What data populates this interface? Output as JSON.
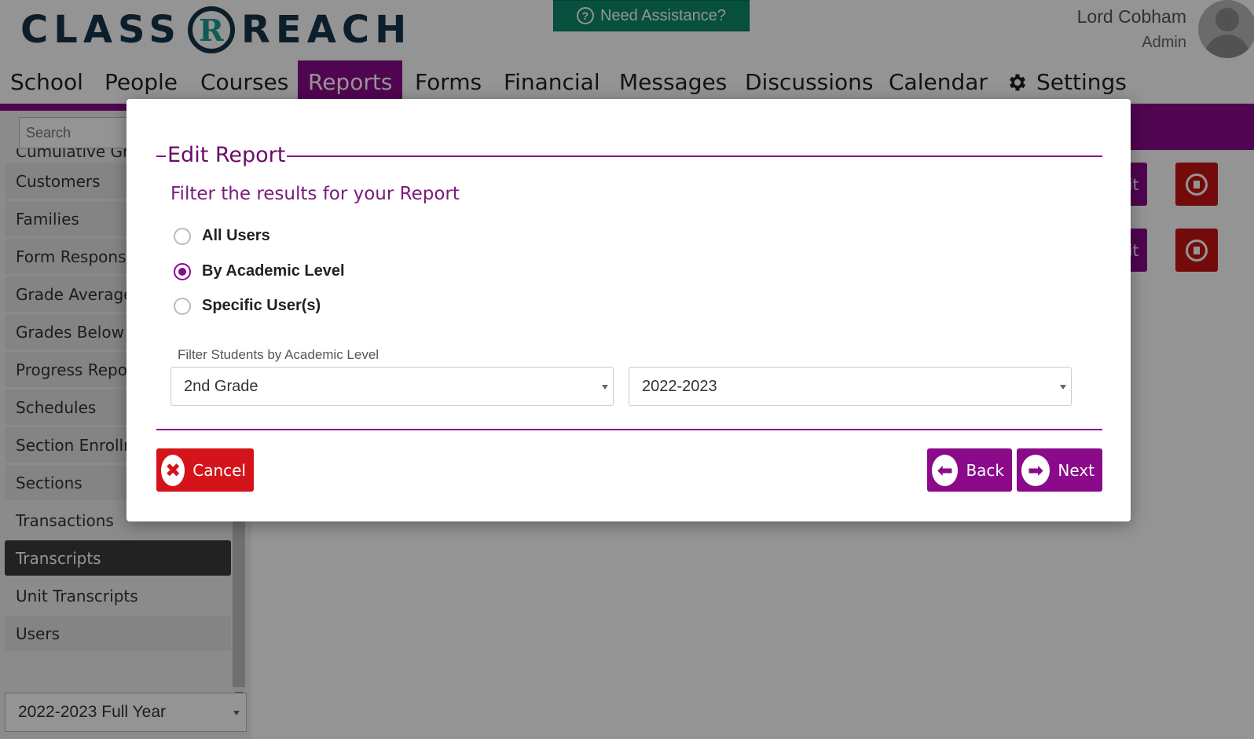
{
  "header": {
    "logo_left": "CLASS",
    "logo_mark": "R",
    "logo_right": "REACH",
    "assist_label": "Need Assistance?",
    "user_name": "Lord Cobham",
    "user_role": "Admin"
  },
  "nav": {
    "items": [
      {
        "label": "School"
      },
      {
        "label": "People"
      },
      {
        "label": "Courses"
      },
      {
        "label": "Reports",
        "active": true
      },
      {
        "label": "Forms"
      },
      {
        "label": "Financial"
      },
      {
        "label": "Messages"
      },
      {
        "label": "Discussions"
      },
      {
        "label": "Calendar"
      },
      {
        "label": "Settings",
        "icon": "gear-icon"
      }
    ]
  },
  "sidebar": {
    "search_placeholder": "Search",
    "items": [
      {
        "label": "Cumulative Gra"
      },
      {
        "label": "Customers"
      },
      {
        "label": "Families"
      },
      {
        "label": "Form Responses"
      },
      {
        "label": "Grade Averages"
      },
      {
        "label": "Grades Below (("
      },
      {
        "label": "Progress Report"
      },
      {
        "label": "Schedules"
      },
      {
        "label": "Section Enrollm"
      },
      {
        "label": "Sections"
      },
      {
        "label": "Transactions"
      },
      {
        "label": "Transcripts",
        "active": true
      },
      {
        "label": "Unit Transcripts"
      },
      {
        "label": "Users"
      }
    ],
    "term_select": "2022-2023 Full Year"
  },
  "rows": {
    "edit_label": "Edit"
  },
  "modal": {
    "legend": "Edit Report",
    "subtitle": "Filter the results for your Report",
    "options": [
      {
        "label": "All Users",
        "checked": false
      },
      {
        "label": "By Academic Level",
        "checked": true
      },
      {
        "label": "Specific User(s)",
        "checked": false
      }
    ],
    "filter_label": "Filter Students by Academic Level",
    "level_select": "2nd Grade",
    "year_select": "2022-2023",
    "cancel_label": "Cancel",
    "back_label": "Back",
    "next_label": "Next"
  },
  "colors": {
    "brand_purple": "#8a0a8a",
    "danger_red": "#d4141a",
    "assist_green": "#0d8a6c",
    "logo_navy": "#17344a"
  }
}
